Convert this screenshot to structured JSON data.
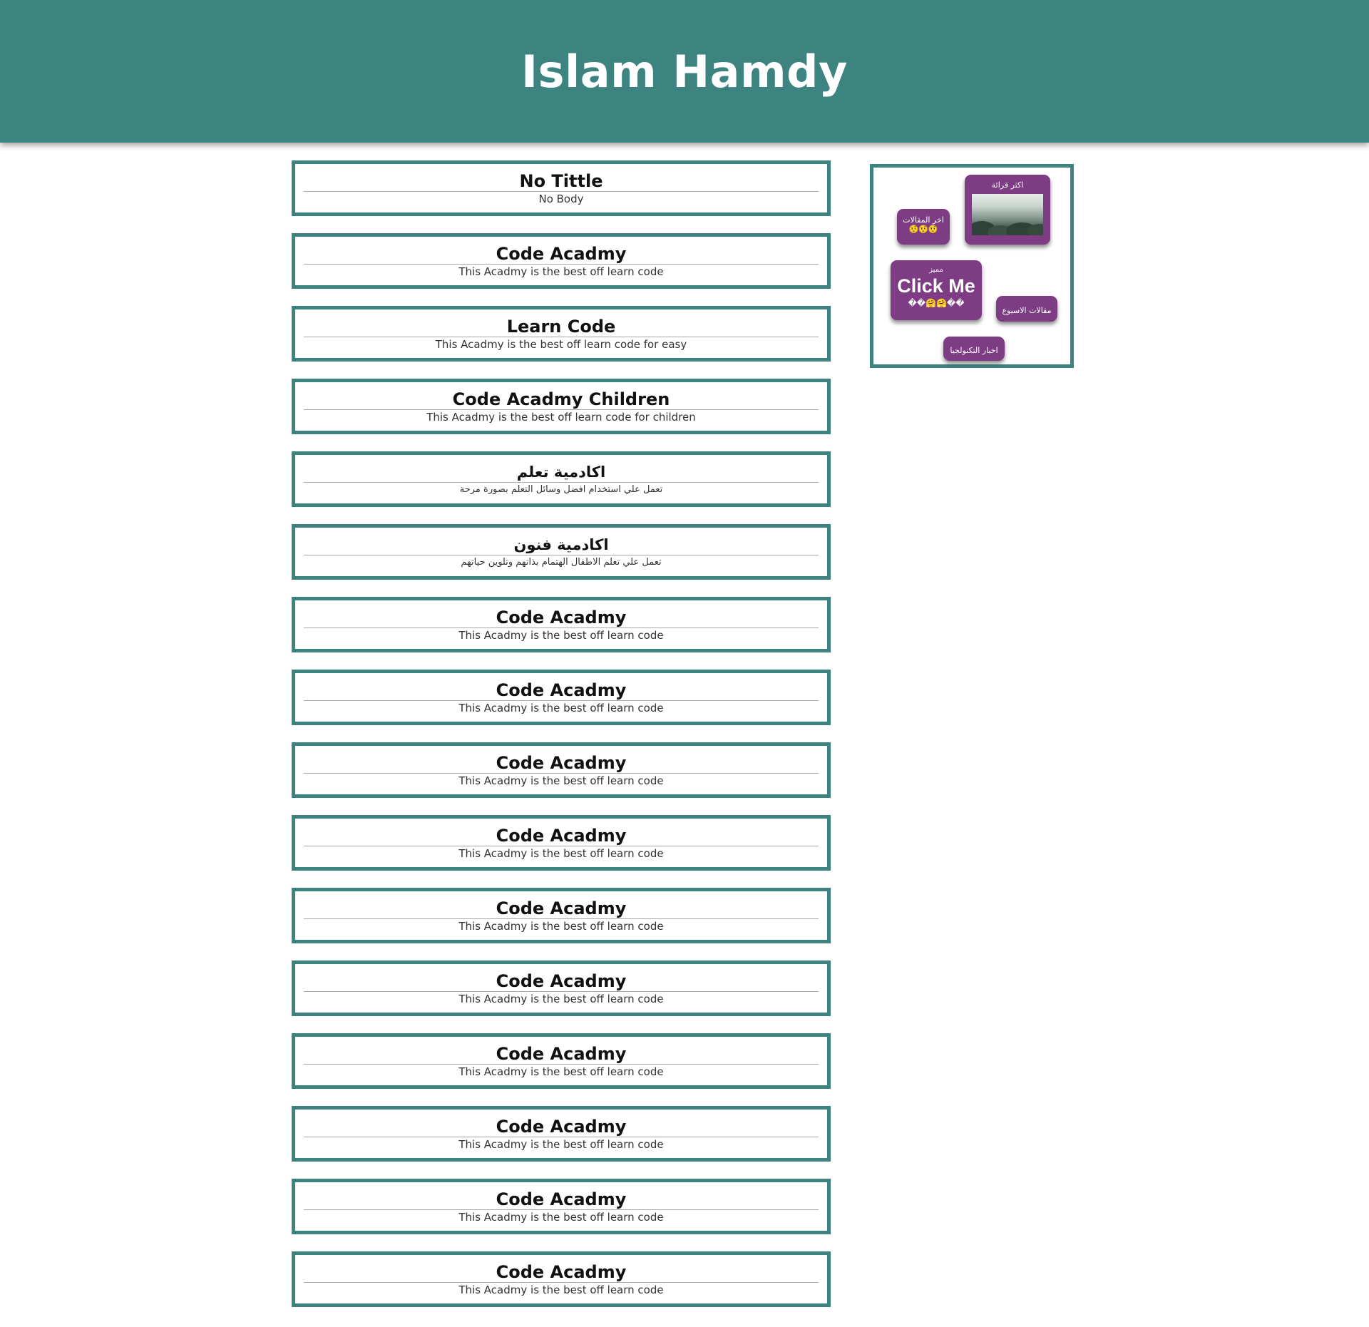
{
  "header": {
    "title": "Islam Hamdy",
    "background_color": "#3d8380"
  },
  "posts": [
    {
      "title": "No Tittle",
      "body": "No Body"
    },
    {
      "title": "Code Acadmy",
      "body": "This Acadmy is the best off learn code"
    },
    {
      "title": "Learn Code",
      "body": "This Acadmy is the best off learn code for easy"
    },
    {
      "title": "Code Acadmy Children",
      "body": "This Acadmy is the best off learn code for children"
    },
    {
      "title": "اكادمية تعلم",
      "body": "تعمل علي استخدام افضل وسائل التعلم بصورة مرحة"
    },
    {
      "title": "اكادمية فنون",
      "body": "تعمل علي تعلم الاطفال الهتمام بذاتهم وتلوين حياتهم"
    },
    {
      "title": "Code Acadmy",
      "body": "This Acadmy is the best off learn code"
    },
    {
      "title": "Code Acadmy",
      "body": "This Acadmy is the best off learn code"
    },
    {
      "title": "Code Acadmy",
      "body": "This Acadmy is the best off learn code"
    },
    {
      "title": "Code Acadmy",
      "body": "This Acadmy is the best off learn code"
    },
    {
      "title": "Code Acadmy",
      "body": "This Acadmy is the best off learn code"
    },
    {
      "title": "Code Acadmy",
      "body": "This Acadmy is the best off learn code"
    },
    {
      "title": "Code Acadmy",
      "body": "This Acadmy is the best off learn code"
    },
    {
      "title": "Code Acadmy",
      "body": "This Acadmy is the best off learn code"
    },
    {
      "title": "Code Acadmy",
      "body": "This Acadmy is the best off learn code"
    },
    {
      "title": "Code Acadmy",
      "body": "This Acadmy is the best off learn code"
    }
  ],
  "sidebar": {
    "most_read": {
      "label": "اكثر قرائة"
    },
    "latest": {
      "label": "اخر المقالات",
      "emojis": "🤨🤨🤨"
    },
    "featured": {
      "label": "مميز",
      "big": "Click Me",
      "emojis": "��🤗🤗��"
    },
    "week": {
      "label": "مقالات الاسبوع"
    },
    "tech": {
      "label": "اخبار التكنولجيا"
    },
    "tag_color": "#7d3c84",
    "border_color": "#3d8380"
  }
}
